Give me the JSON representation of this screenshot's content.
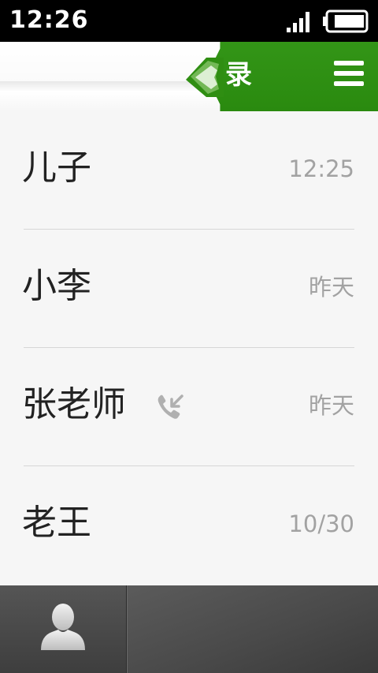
{
  "status_bar": {
    "time": "12:26",
    "signal_icon": "signal-bars-icon",
    "battery_icon": "battery-icon"
  },
  "header": {
    "title": "录",
    "menu_icon": "menu-icon",
    "accent_color": "#2f8e12"
  },
  "calls": [
    {
      "name": "儿子",
      "time": "12:25",
      "incoming": false
    },
    {
      "name": "小李",
      "time": "昨天",
      "incoming": false
    },
    {
      "name": "张老师",
      "time": "昨天",
      "incoming": true
    },
    {
      "name": "老王",
      "time": "10/30",
      "incoming": false
    }
  ],
  "bottom_bar": {
    "contacts_icon": "person-silhouette-icon"
  }
}
